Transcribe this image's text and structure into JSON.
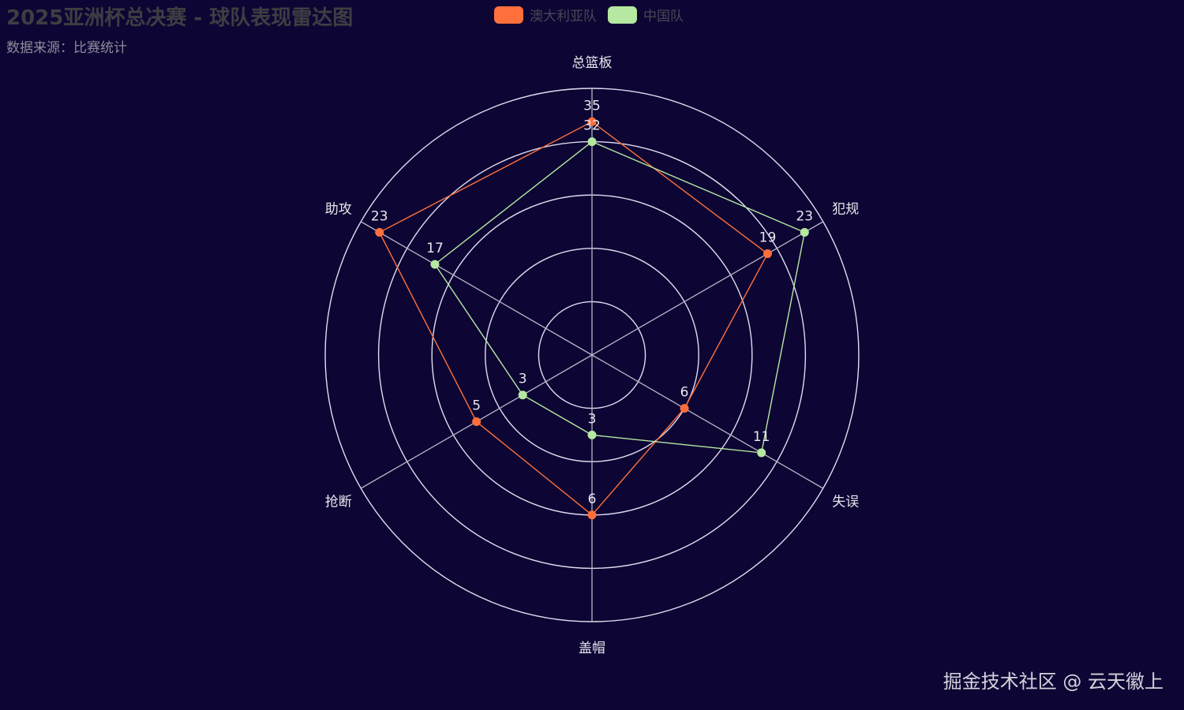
{
  "chart_data": {
    "type": "radar",
    "title": "2025亚洲杯总决赛 - 球队表现雷达图",
    "subtitle": "数据来源：比赛统计",
    "indicators": [
      {
        "name": "总篮板",
        "max": 40
      },
      {
        "name": "犯规",
        "max": 25
      },
      {
        "name": "失误",
        "max": 15
      },
      {
        "name": "盖帽",
        "max": 10
      },
      {
        "name": "抢断",
        "max": 10
      },
      {
        "name": "助攻",
        "max": 25
      }
    ],
    "series": [
      {
        "name": "澳大利亚队",
        "color": "#ff6f3c",
        "values": [
          35,
          19,
          6,
          6,
          5,
          23
        ]
      },
      {
        "name": "中国队",
        "color": "#b5e8a0",
        "values": [
          32,
          23,
          11,
          3,
          3,
          17
        ]
      }
    ],
    "rings": 5,
    "legend_position": "top-center",
    "grid_color": "#e0dcf0",
    "background": "#0d0634"
  },
  "watermark": "掘金技术社区 @ 云天徽上"
}
